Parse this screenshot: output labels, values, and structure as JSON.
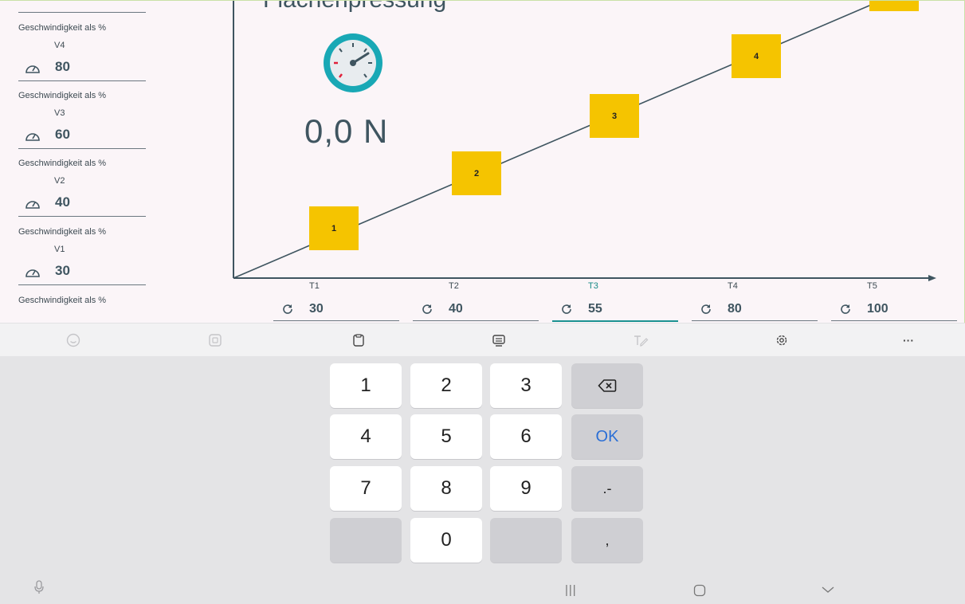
{
  "app": {
    "title": "Flächenpressung",
    "force": "0,0 N",
    "speed_fields": [
      {
        "label": "Geschwindigkeit als %",
        "sub": "V4",
        "value": "80"
      },
      {
        "label": "Geschwindigkeit als %",
        "sub": "V3",
        "value": "60"
      },
      {
        "label": "Geschwindigkeit als %",
        "sub": "V2",
        "value": "40"
      },
      {
        "label": "Geschwindigkeit als %",
        "sub": "V1",
        "value": "30"
      }
    ],
    "last_label": "Geschwindigkeit als %",
    "time_fields": [
      {
        "sub": "T1",
        "value": "30"
      },
      {
        "sub": "T2",
        "value": "40"
      },
      {
        "sub": "T3",
        "value": "55"
      },
      {
        "sub": "T4",
        "value": "80"
      },
      {
        "sub": "T5",
        "value": "100"
      }
    ],
    "steps": [
      "1",
      "2",
      "3",
      "4"
    ],
    "colors": {
      "accent": "#1a9190",
      "step_box": "#f5c400",
      "text": "#3f5560"
    }
  },
  "keyboard": {
    "toolbar_icons": [
      "emoji-icon",
      "stickers-icon",
      "clipboard-icon",
      "keyboard-mode-icon",
      "handwriting-icon",
      "settings-icon",
      "more-icon"
    ],
    "more_label": "···",
    "keys": {
      "k1": "1",
      "k2": "2",
      "k3": "3",
      "k4": "4",
      "k5": "5",
      "k6": "6",
      "k7": "7",
      "k8": "8",
      "k9": "9",
      "k0": "0",
      "ok": "OK",
      "dotminus": ".-",
      "comma": ","
    }
  },
  "navbar": {
    "recents": "|||",
    "back": "⌵"
  }
}
